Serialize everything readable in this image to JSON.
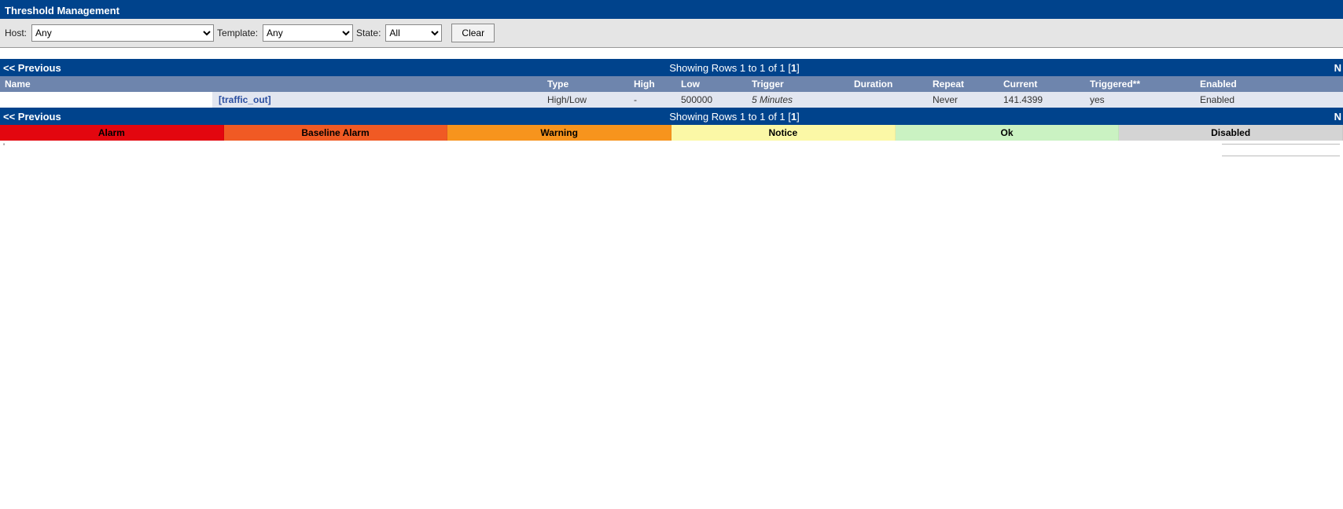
{
  "header": {
    "title": "Threshold Management"
  },
  "filters": {
    "host_label": "Host:",
    "host_value": "Any",
    "template_label": "Template:",
    "template_value": "Any",
    "state_label": "State:",
    "state_value": "All",
    "clear_label": "Clear"
  },
  "pager": {
    "prev": "<< Previous",
    "center_prefix": "Showing Rows 1 to 1 of 1 [",
    "center_bold": "1",
    "center_suffix": "]",
    "next": "N"
  },
  "columns": {
    "name": "Name",
    "type": "Type",
    "high": "High",
    "low": "Low",
    "trigger": "Trigger",
    "duration": "Duration",
    "repeat": "Repeat",
    "current": "Current",
    "triggered": "Triggered**",
    "enabled": "Enabled"
  },
  "rows": [
    {
      "name_suffix": " [traffic_out]",
      "type": "High/Low",
      "high": "-",
      "low": "500000",
      "trigger": "5 Minutes",
      "duration": "",
      "repeat": "Never",
      "current": "141.4399",
      "triggered": "yes",
      "enabled": "Enabled"
    }
  ],
  "legend": {
    "alarm": "Alarm",
    "baseline": "Baseline Alarm",
    "warning": "Warning",
    "notice": "Notice",
    "ok": "Ok",
    "disabled": "Disabled"
  },
  "tick": "'"
}
